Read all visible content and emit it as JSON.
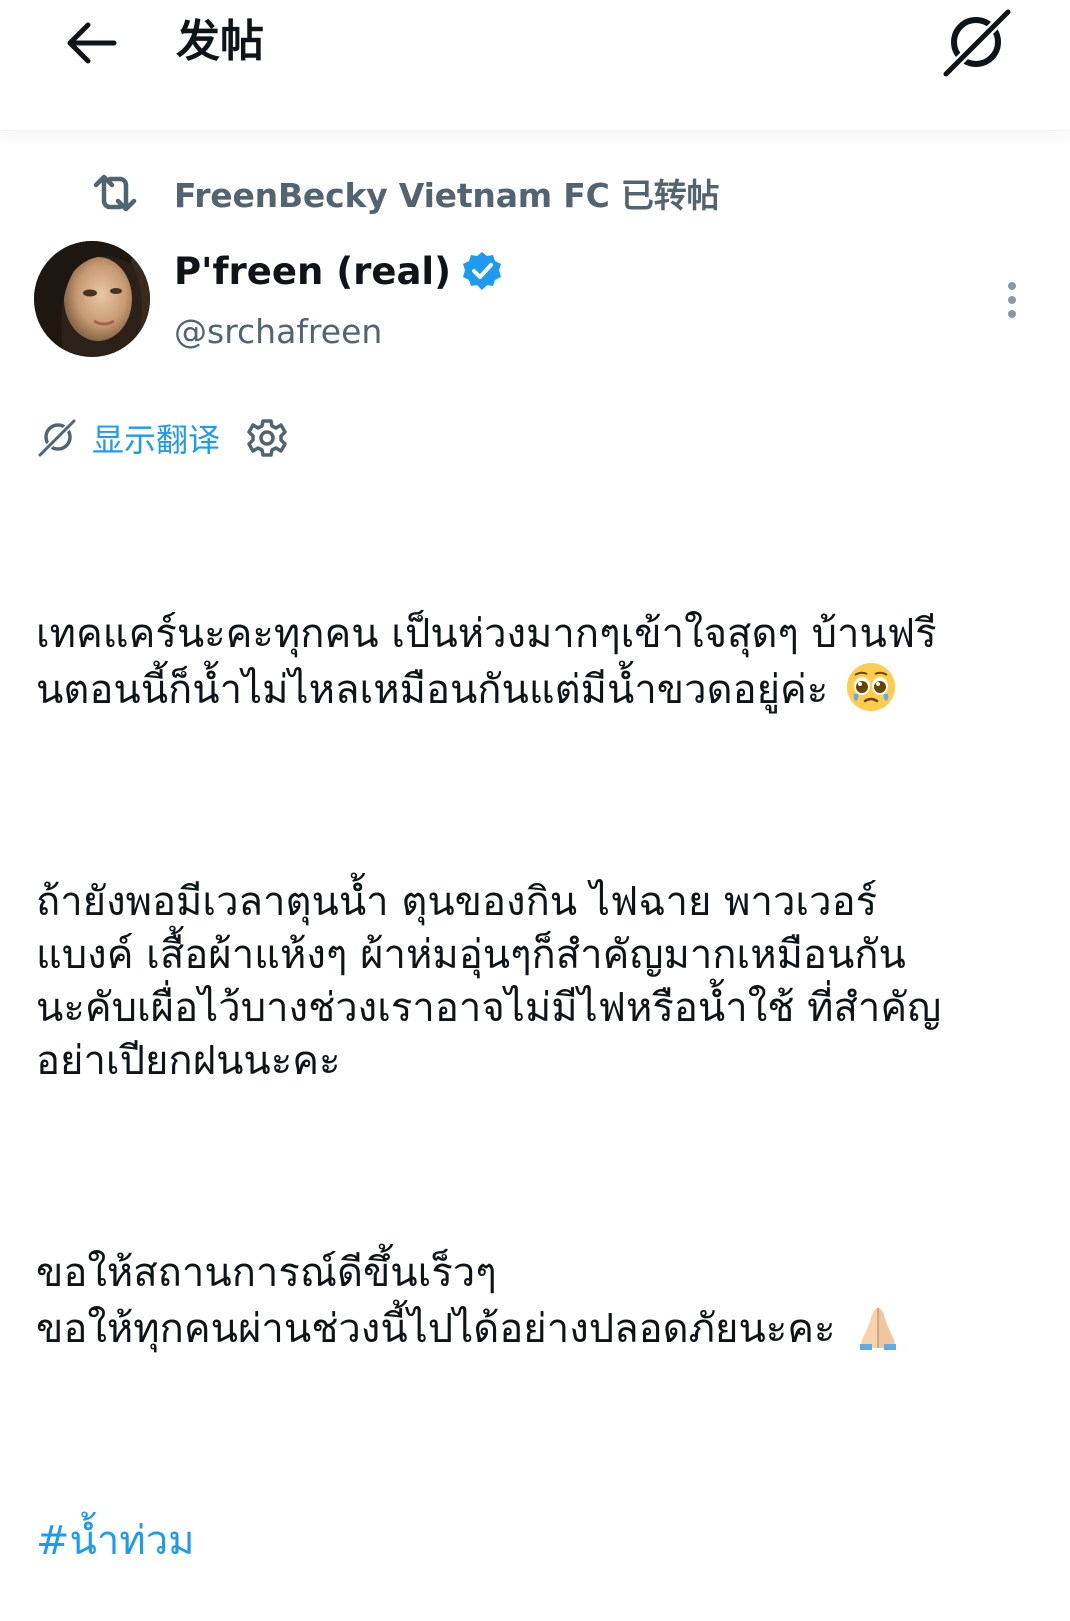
{
  "header": {
    "title": "发帖",
    "back_icon": "arrow-left-icon",
    "translate_icon": "translate-icon"
  },
  "repost": {
    "icon": "repost-icon",
    "text": "FreenBecky Vietnam FC 已转帖"
  },
  "author": {
    "name": "P'freen (real)",
    "handle": "@srchafreen",
    "verified": true,
    "verified_color": "#1d9bf0"
  },
  "translate": {
    "label": "显示翻译",
    "settings_icon": "gear-icon"
  },
  "tweet": {
    "paragraph1_line1": "เทคแคร์นะคะทุกคน เป็นห่วงมากๆเข้าใจสุดๆ บ้านฟรี",
    "paragraph1_line2": "นตอนนี้ก็น้ำไม่ไหลเหมือนกันแต่มีน้ำขวดอยู่ค่ะ",
    "emoji1": "pleading-face-emoji",
    "paragraph2_line1": "ถ้ายังพอมีเวลาตุนน้ำ ตุนของกิน ไฟฉาย พาวเวอร์",
    "paragraph2_line2": "แบงค์ เสื้อผ้าแห้งๆ ผ้าห่มอุ่นๆก็สำคัญมากเหมือนกัน",
    "paragraph2_line3": "นะคับเผื่อไว้บางช่วงเราอาจไม่มีไฟหรือน้ำใช้ ที่สำคัญ",
    "paragraph2_line4": "อย่าเปียกฝนนะคะ",
    "paragraph3_line1": "ขอให้สถานการณ์ดีขึ้นเร็วๆ",
    "paragraph3_line2": "ขอให้ทุกคนผ่านช่วงนี้ไปได้อย่างปลอดภัยนะคะ",
    "emoji2": "folded-hands-emoji",
    "hashtag": "#น้ำท่วม"
  },
  "colors": {
    "accent": "#1d9bf0",
    "secondary_text": "#536471",
    "primary_text": "#0f1419"
  }
}
